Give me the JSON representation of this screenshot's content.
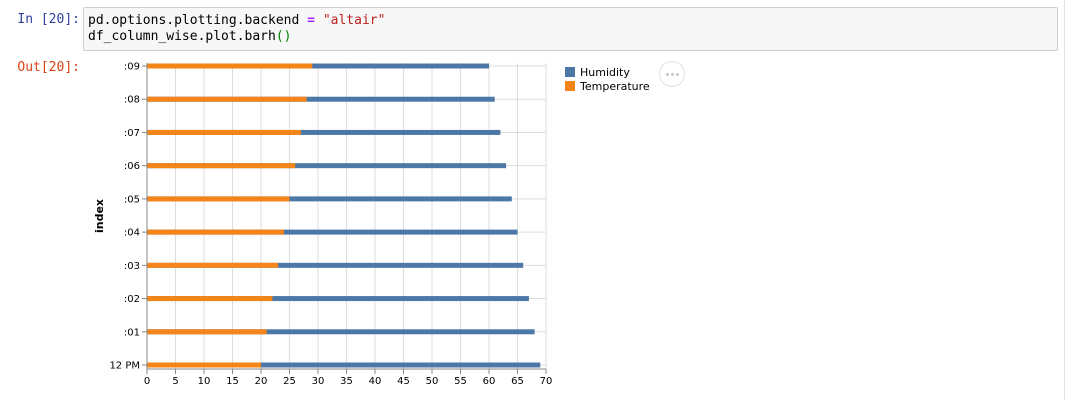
{
  "notebook": {
    "in_prompt": "In [20]:",
    "out_prompt": "Out[20]:",
    "code_line1": {
      "part1": "pd.options.plotting.backend ",
      "op": "=",
      "part2": " ",
      "str": "\"altair\""
    },
    "code_line2": {
      "part1": "df_column_wise.plot.barh",
      "paren": "()"
    }
  },
  "actions_menu": {
    "icon": "ellipsis-icon"
  },
  "chart_data": {
    "type": "bar",
    "orientation": "horizontal",
    "stacked": false,
    "ylabel": "index",
    "xlabel": "",
    "categories": [
      "12 PM",
      ":01",
      ":02",
      ":03",
      ":04",
      ":05",
      ":06",
      ":07",
      ":08",
      ":09"
    ],
    "series": [
      {
        "name": "Humidity",
        "color": "#4c78a8",
        "values": [
          69,
          68,
          67,
          66,
          65,
          64,
          63,
          62,
          61,
          60
        ]
      },
      {
        "name": "Temperature",
        "color": "#f58518",
        "values": [
          20,
          21,
          22,
          23,
          24,
          25,
          26,
          27,
          28,
          29
        ]
      }
    ],
    "xlim": [
      0,
      70
    ],
    "xticks": [
      0,
      5,
      10,
      15,
      20,
      25,
      30,
      35,
      40,
      45,
      50,
      55,
      60,
      65,
      70
    ],
    "grid": true,
    "legend": "right"
  }
}
